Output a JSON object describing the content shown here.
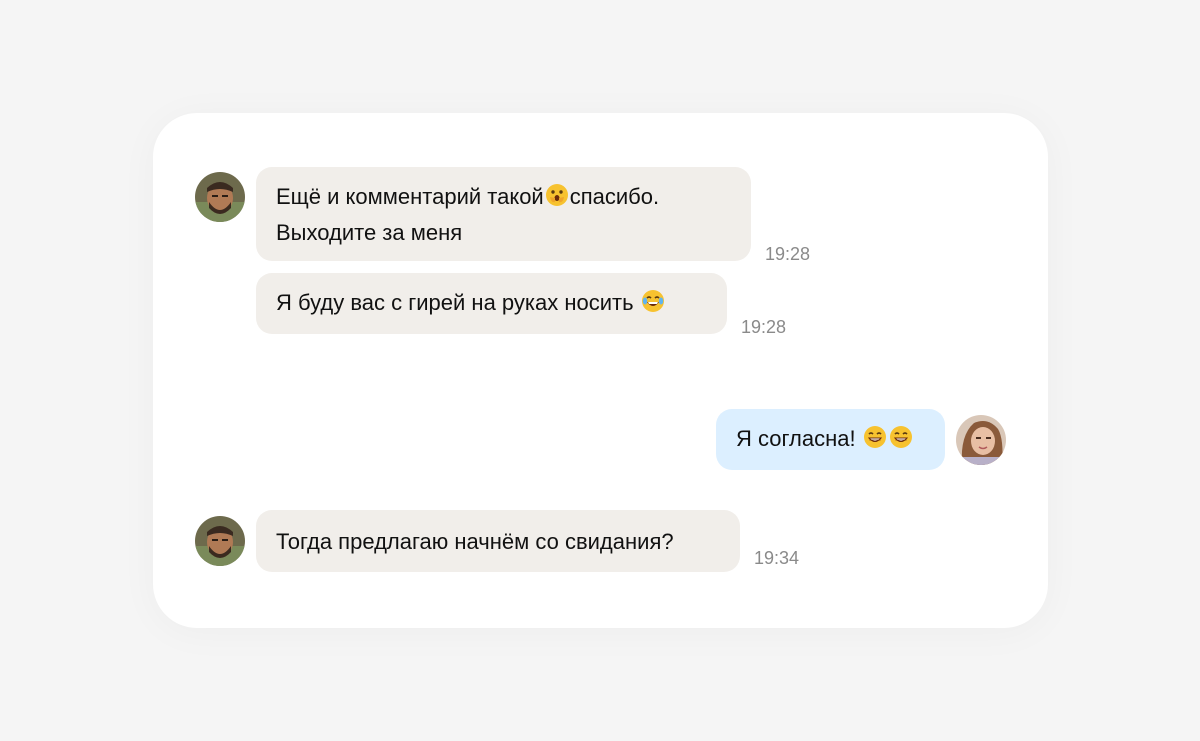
{
  "chat": {
    "messages": [
      {
        "side": "in",
        "text_before": "Ещё и комментарий такой",
        "emoji": "face-with-hand-over-mouth-emoji",
        "text_after": "спасибо.",
        "text_line2": "Выходите за меня",
        "time": "19:28"
      },
      {
        "side": "in",
        "text_before": "Я буду вас с гирей на руках носить",
        "emoji": "tears-of-joy-emoji",
        "time": "19:28"
      },
      {
        "side": "out",
        "text_before": "Я согласна!",
        "emoji": "grinning-face-emoji",
        "emoji_count": 2
      },
      {
        "side": "in",
        "text_before": "Тогда предлагаю начнём со свидания?",
        "time": "19:34"
      }
    ]
  },
  "avatars": {
    "sender": "man-avatar",
    "receiver": "woman-avatar"
  },
  "colors": {
    "incoming_bubble": "#f1eeea",
    "outgoing_bubble": "#dcefff",
    "time_text": "#8a8a8a",
    "card_bg": "#ffffff",
    "page_bg": "#f5f5f5"
  }
}
